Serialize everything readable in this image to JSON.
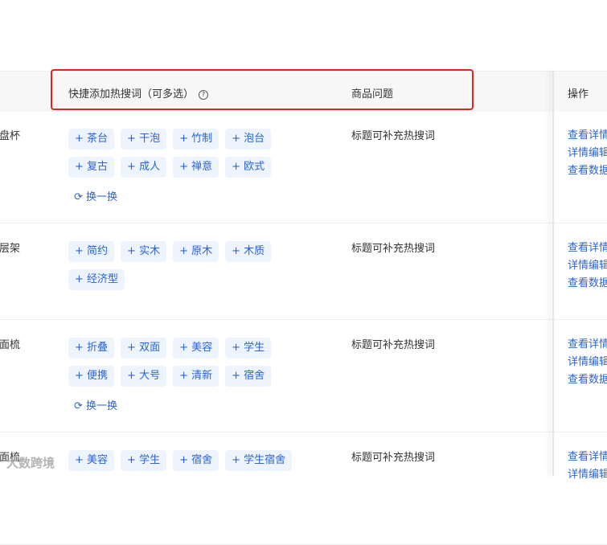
{
  "columns": {
    "hot_words": "快捷添加热搜词（可多选）",
    "help": "?",
    "issue": "商品问题",
    "ops": "操作"
  },
  "refresh_label": "换一换",
  "rows": [
    {
      "name": "茶盘杯",
      "tags": [
        "茶台",
        "干泡",
        "竹制",
        "泡台",
        "复古",
        "成人",
        "禅意",
        "欧式"
      ],
      "issue": "标题可补充热搜词",
      "ops": [
        "查看详情",
        "详情编辑",
        "查看数据"
      ]
    },
    {
      "name": "多层架",
      "tags": [
        "简约",
        "实木",
        "原木",
        "木质",
        "经济型"
      ],
      "issue": "标题可补充热搜词",
      "ops": [
        "查看详情",
        "详情编辑",
        "查看数据"
      ]
    },
    {
      "name": "单面梳",
      "tags": [
        "折叠",
        "双面",
        "美容",
        "学生",
        "便携",
        "大号",
        "清新",
        "宿舍"
      ],
      "issue": "标题可补充热搜词",
      "ops": [
        "查看详情",
        "详情编辑",
        "查看数据"
      ]
    },
    {
      "name": "单面梳",
      "tags": [
        "美容",
        "学生",
        "宿舍",
        "学生宿舍"
      ],
      "issue": "标题可补充热搜词",
      "ops": [
        "查看详情",
        "详情编辑"
      ]
    }
  ],
  "watermark": "大数跨境"
}
